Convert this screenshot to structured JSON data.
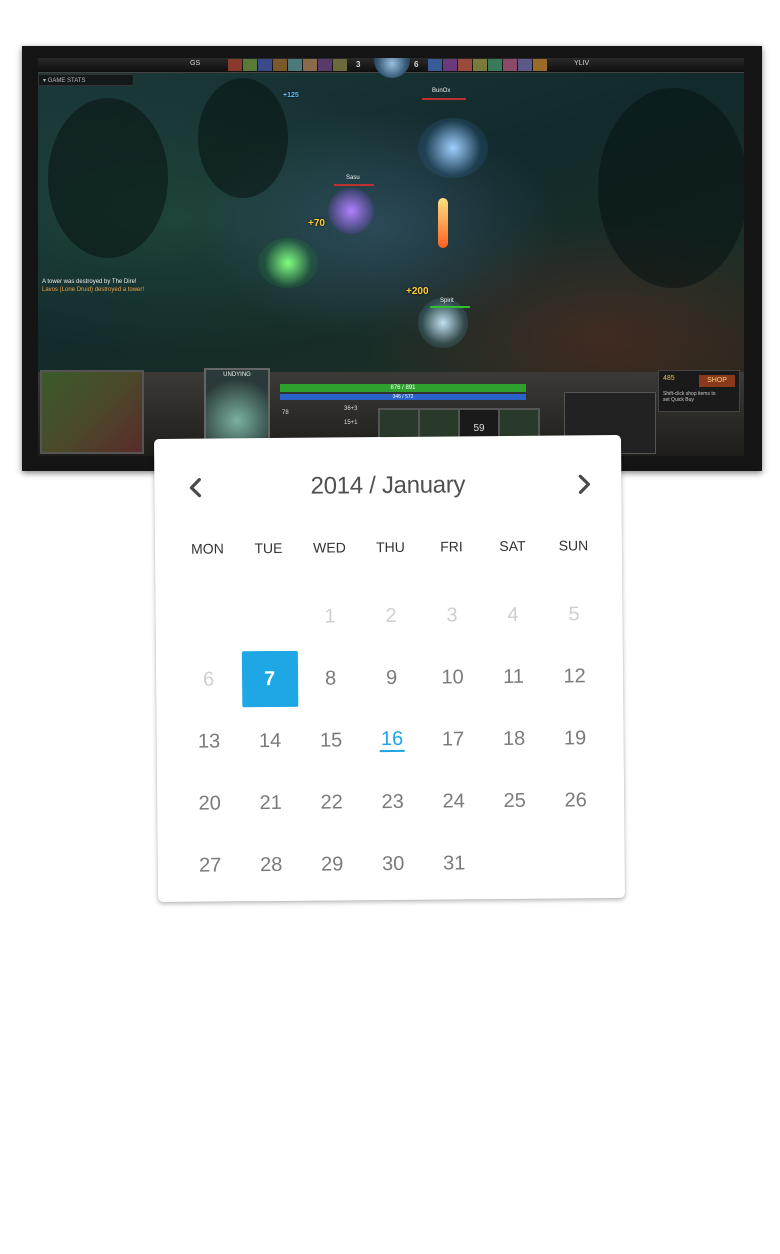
{
  "game": {
    "team_left_tag": "GS",
    "team_right_tag": "YLIV",
    "score_left": "3",
    "score_right": "6",
    "game_stats_label": "GAME STATS",
    "killfeed": [
      "A tower was destroyed by The Dire!",
      "Lavos (Lone Druid) destroyed a tower!"
    ],
    "floating": [
      "+70",
      "+200",
      "+125"
    ],
    "hero_labels": [
      "Sasu",
      "BunOx",
      "Spirit"
    ],
    "hero_name": "UNDYING",
    "hp_text": "876 / 891",
    "mana_text": "346 / 572",
    "stat_values": [
      "78",
      "36+3",
      "15+1"
    ],
    "ability_cooldown": "59",
    "gold": "485",
    "shop_label": "SHOP",
    "shop_hint": "Shift-click shop items to set Quick Buy"
  },
  "calendar": {
    "title": "2014 / January",
    "prev_icon": "chevron-left-icon",
    "next_icon": "chevron-right-icon",
    "weekdays": [
      "MON",
      "TUE",
      "WED",
      "THU",
      "FRI",
      "SAT",
      "SUN"
    ],
    "selected_day": "7",
    "today_day": "16",
    "accent_color": "#1ea7e4",
    "weeks": [
      [
        "",
        "",
        "1",
        "2",
        "3",
        "4",
        "5"
      ],
      [
        "6",
        "7",
        "8",
        "9",
        "10",
        "11",
        "12"
      ],
      [
        "13",
        "14",
        "15",
        "16",
        "17",
        "18",
        "19"
      ],
      [
        "20",
        "21",
        "22",
        "23",
        "24",
        "25",
        "26"
      ],
      [
        "27",
        "28",
        "29",
        "30",
        "31",
        "",
        ""
      ]
    ]
  }
}
